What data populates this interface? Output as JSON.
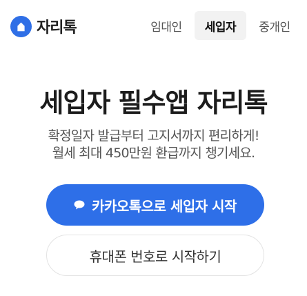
{
  "brand": {
    "name": "자리톡"
  },
  "nav": {
    "tabs": [
      {
        "label": "임대인"
      },
      {
        "label": "세입자"
      },
      {
        "label": "중개인"
      }
    ],
    "active": "세입자"
  },
  "hero": {
    "title": "세입자 필수앱 자리톡",
    "line1": "확정일자 발급부터 고지서까지 편리하게!",
    "line2": "월세 최대 450만원 환급까지 챙기세요."
  },
  "actions": {
    "kakao_label": "카카오톡으로 세입자 시작",
    "phone_label": "휴대폰 번호로 시작하기"
  },
  "colors": {
    "primary": "#2e6fe8",
    "active_tab_bg": "#f2f2f2"
  }
}
